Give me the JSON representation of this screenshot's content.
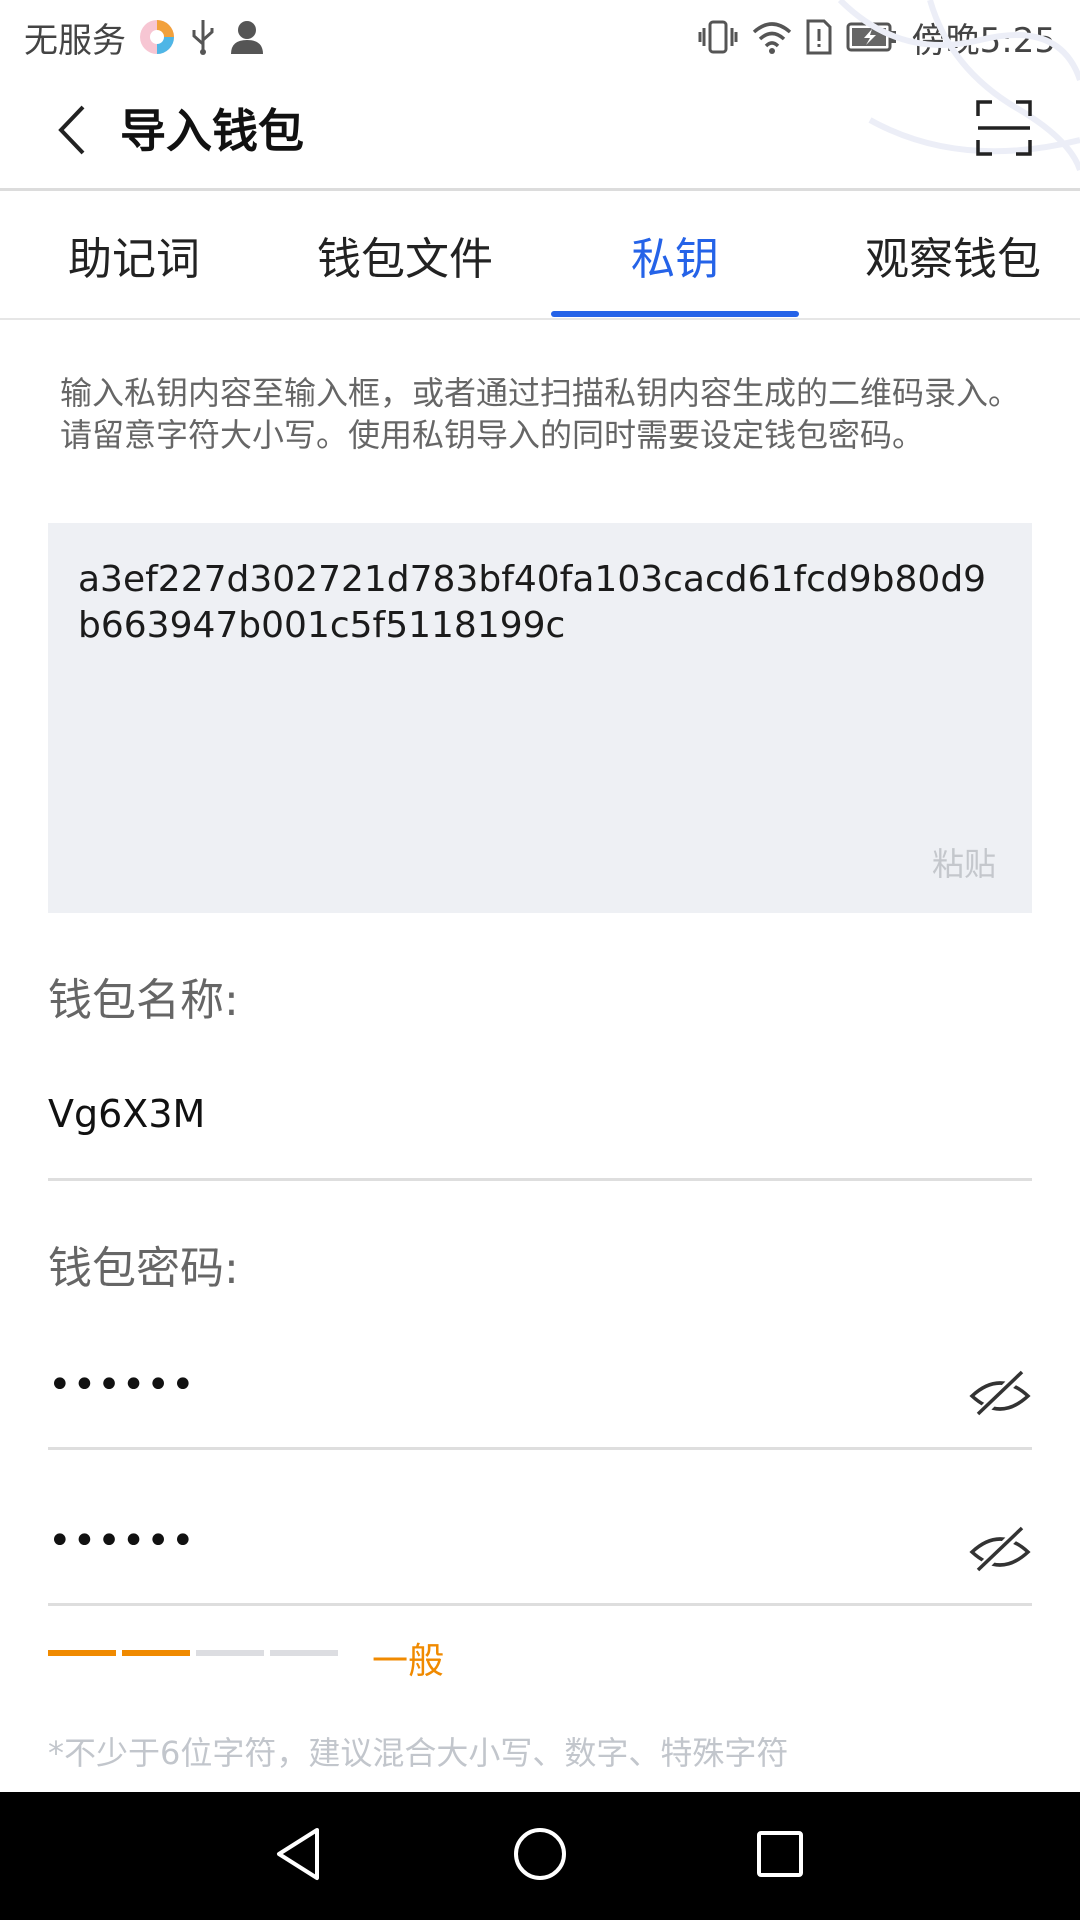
{
  "status_bar": {
    "carrier": "无服务",
    "time_prefix": "傍晚",
    "time": "5:25"
  },
  "header": {
    "title": "导入钱包",
    "back_icon": "chevron-left-icon",
    "scan_icon": "scan-icon"
  },
  "tabs": [
    {
      "label": "助记词",
      "active": false
    },
    {
      "label": "钱包文件",
      "active": false
    },
    {
      "label": "私钥",
      "active": true
    },
    {
      "label": "观察钱包",
      "active": false
    }
  ],
  "description": "输入私钥内容至输入框，或者通过扫描私钥内容生成的二维码录入。请留意字符大小写。使用私钥导入的同时需要设定钱包密码。",
  "private_key": {
    "value": "a3ef227d302721d783bf40fa103cacd61fcd9b80d9b663947b001c5f5118199c",
    "paste_label": "粘贴"
  },
  "wallet_name": {
    "label": "钱包名称:",
    "value": "Vg6X3M"
  },
  "wallet_password": {
    "label": "钱包密码:",
    "password_masked": "••••••",
    "confirm_masked": "••••••"
  },
  "strength": {
    "level_text": "一般",
    "filled_segments": 2,
    "total_segments": 4,
    "colors": {
      "filled": "#f08a00",
      "empty": "#dcdde1"
    }
  },
  "hint": "*不少于6位字符，建议混合大小写、数字、特殊字符",
  "colors": {
    "accent": "#2563e8",
    "keybox_bg": "#eef0f4",
    "warning": "#f08a00"
  }
}
